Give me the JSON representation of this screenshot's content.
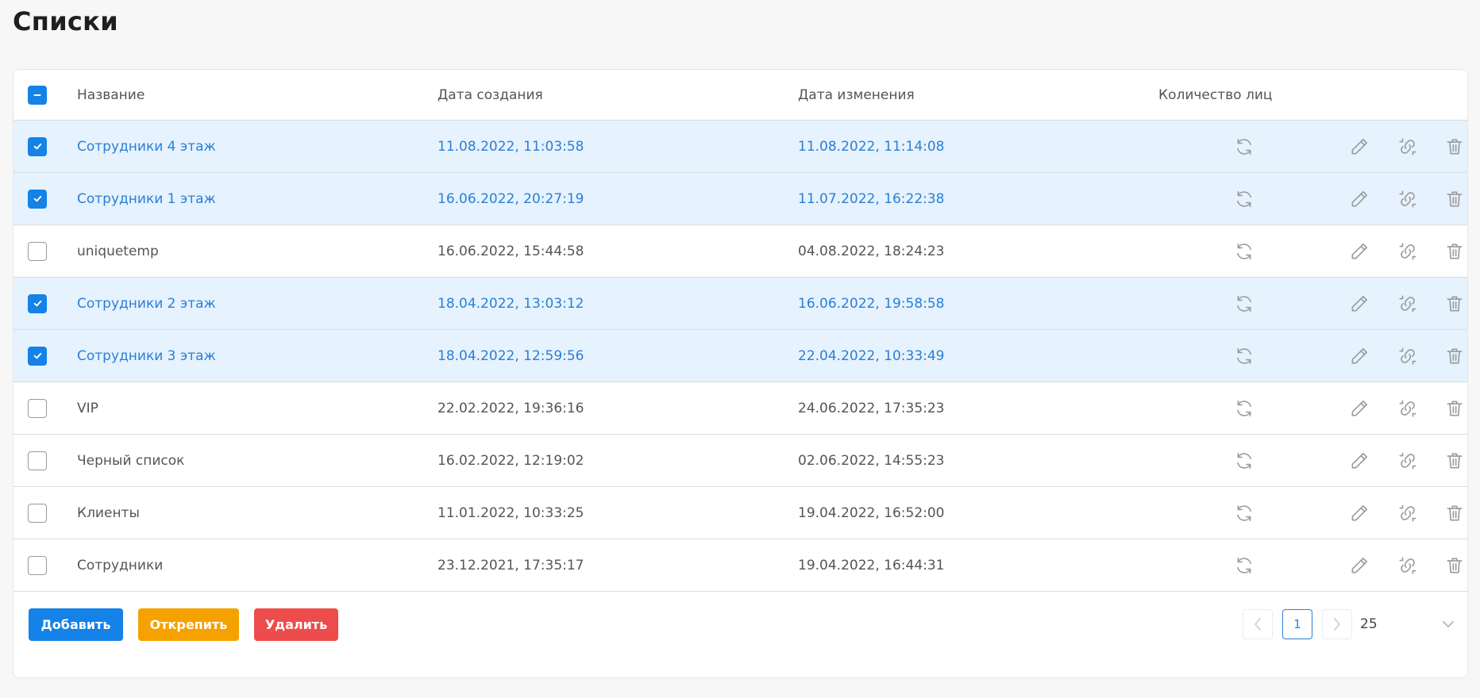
{
  "page": {
    "title": "Списки"
  },
  "table": {
    "columns": {
      "name": "Название",
      "created": "Дата создания",
      "modified": "Дата изменения",
      "count": "Количество лиц"
    },
    "header_checkbox_state": "indeterminate",
    "rows": [
      {
        "selected": true,
        "name": "Сотрудники 4 этаж",
        "created": "11.08.2022, 11:03:58",
        "modified": "11.08.2022, 11:14:08"
      },
      {
        "selected": true,
        "name": "Сотрудники 1 этаж",
        "created": "16.06.2022, 20:27:19",
        "modified": "11.07.2022, 16:22:38"
      },
      {
        "selected": false,
        "name": "uniquetemp",
        "created": "16.06.2022, 15:44:58",
        "modified": "04.08.2022, 18:24:23"
      },
      {
        "selected": true,
        "name": "Сотрудники 2 этаж",
        "created": "18.04.2022, 13:03:12",
        "modified": "16.06.2022, 19:58:58"
      },
      {
        "selected": true,
        "name": "Сотрудники 3 этаж",
        "created": "18.04.2022, 12:59:56",
        "modified": "22.04.2022, 10:33:49"
      },
      {
        "selected": false,
        "name": "VIP",
        "created": "22.02.2022, 19:36:16",
        "modified": "24.06.2022, 17:35:23"
      },
      {
        "selected": false,
        "name": "Черный список",
        "created": "16.02.2022, 12:19:02",
        "modified": "02.06.2022, 14:55:23"
      },
      {
        "selected": false,
        "name": "Клиенты",
        "created": "11.01.2022, 10:33:25",
        "modified": "19.04.2022, 16:52:00"
      },
      {
        "selected": false,
        "name": "Сотрудники",
        "created": "23.12.2021, 17:35:17",
        "modified": "19.04.2022, 16:44:31"
      }
    ],
    "row_icons": [
      "refresh-icon",
      "pencil-icon",
      "unlink-icon",
      "trash-icon"
    ]
  },
  "footer": {
    "add_label": "Добавить",
    "unpin_label": "Открепить",
    "delete_label": "Удалить",
    "current_page": "1",
    "page_size": "25"
  },
  "colors": {
    "accent": "#1482e6",
    "selected_row": "#e6f2fd",
    "selected_text": "#2a7fd6",
    "unpin": "#f5a100",
    "danger": "#ee4c4c",
    "icon": "#9a9a9a"
  }
}
